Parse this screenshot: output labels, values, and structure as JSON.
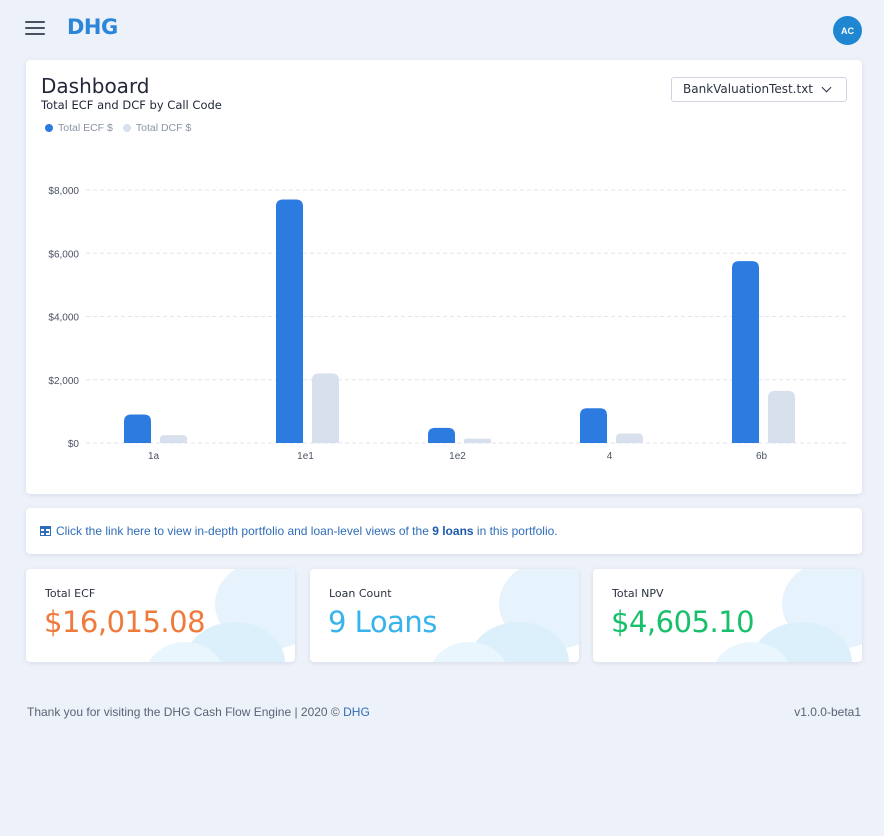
{
  "header": {
    "logo": "DHG",
    "avatar_initials": "AC"
  },
  "dashboard": {
    "title": "Dashboard",
    "subtitle": "Total ECF and DCF by Call Code",
    "file_select": "BankValuationTest.txt",
    "legend": [
      "Total ECF $",
      "Total DCF $"
    ]
  },
  "chart_data": {
    "type": "bar",
    "title": "Total ECF and DCF by Call Code",
    "categories": [
      "1a",
      "1e1",
      "1e2",
      "4",
      "6b"
    ],
    "series": [
      {
        "name": "Total ECF $",
        "values": [
          900,
          7700,
          480,
          1100,
          5750
        ],
        "color": "#2b7be0"
      },
      {
        "name": "Total DCF $",
        "values": [
          250,
          2200,
          140,
          300,
          1650
        ],
        "color": "#d7e0ec"
      }
    ],
    "y_ticks": [
      "$0",
      "$2,000",
      "$4,000",
      "$6,000",
      "$8,000"
    ],
    "ylim": [
      0,
      8000
    ],
    "grid": true,
    "legend_position": "top-left"
  },
  "portfolio_link": {
    "prefix": "Click the link here to view in-depth portfolio and loan-level views of the",
    "bold": "9 loans",
    "suffix": "in this portfolio."
  },
  "stats": [
    {
      "label": "Total ECF",
      "value": "$16,015.08",
      "color": "#ef7a3b"
    },
    {
      "label": "Loan Count",
      "value": "9 Loans",
      "color": "#37b4ec"
    },
    {
      "label": "Total NPV",
      "value": "$4,605.10",
      "color": "#17c06b"
    }
  ],
  "footer": {
    "text": "Thank you for visiting the DHG Cash Flow Engine | 2020 ©",
    "link": "DHG",
    "version": "v1.0.0-beta1"
  }
}
